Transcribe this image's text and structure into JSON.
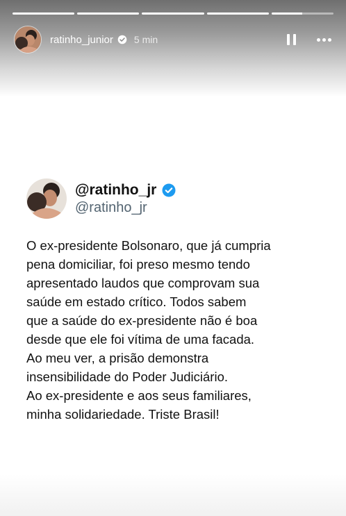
{
  "story": {
    "progress": [
      1,
      1,
      1,
      1,
      0.5
    ],
    "username": "ratinho_junior",
    "time": "5 min",
    "icons": {
      "verified": "verified-badge-icon",
      "pause": "pause-icon",
      "more": "more-icon"
    }
  },
  "tweet": {
    "display_name": "@ratinho_jr",
    "handle": "@ratinho_jr",
    "verified_color": "#1d9bf0",
    "text": "O ex-presidente Bolsonaro, que já cumpria\npena domiciliar, foi preso mesmo tendo\napresentado laudos que comprovam sua\nsaúde em estado crítico. Todos sabem\nque a saúde do ex-presidente não é boa\ndesde que ele foi vítima de uma facada.\nAo meu ver, a prisão demonstra\ninsensibilidade do Poder Judiciário.\nAo ex-presidente e aos seus familiares,\nminha solidariedade. Triste Brasil!"
  }
}
